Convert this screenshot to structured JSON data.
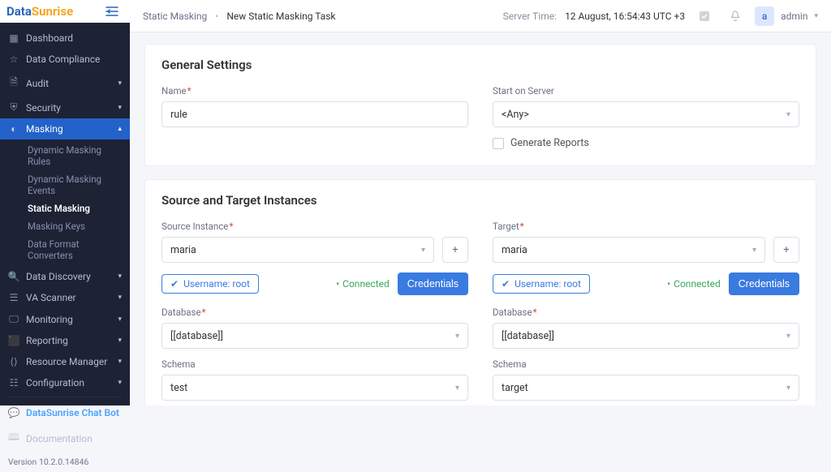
{
  "brand": {
    "part1": "Data",
    "part2": "Sunrise"
  },
  "sidebar": {
    "items": [
      {
        "label": "Dashboard"
      },
      {
        "label": "Data Compliance"
      },
      {
        "label": "Audit"
      },
      {
        "label": "Security"
      },
      {
        "label": "Masking"
      },
      {
        "label": "Data Discovery"
      },
      {
        "label": "VA Scanner"
      },
      {
        "label": "Monitoring"
      },
      {
        "label": "Reporting"
      },
      {
        "label": "Resource Manager"
      },
      {
        "label": "Configuration"
      }
    ],
    "masking_sub": [
      {
        "label": "Dynamic Masking Rules"
      },
      {
        "label": "Dynamic Masking Events"
      },
      {
        "label": "Static Masking"
      },
      {
        "label": "Masking Keys"
      },
      {
        "label": "Data Format Converters"
      }
    ],
    "chatbot": "DataSunrise Chat Bot",
    "documentation": "Documentation",
    "version": "Version 10.2.0.14846"
  },
  "breadcrumb": {
    "root": "Static Masking",
    "current": "New Static Masking Task"
  },
  "header": {
    "server_time_label": "Server Time:",
    "server_time_value": "12 August, 16:54:43  UTC +3",
    "avatar_letter": "a",
    "username": "admin"
  },
  "general": {
    "heading": "General Settings",
    "name_label": "Name",
    "name_value": "rule",
    "start_label": "Start on Server",
    "start_value": "<Any>",
    "generate_reports": "Generate Reports"
  },
  "instances": {
    "heading": "Source and Target Instances",
    "source": {
      "instance_label": "Source Instance",
      "instance_value": "maria",
      "username_chip": "Username: root",
      "connected": "Connected",
      "credentials": "Credentials",
      "db_label": "Database",
      "db_value": "[[database]]",
      "schema_label": "Schema",
      "schema_value": "test"
    },
    "target": {
      "instance_label": "Target",
      "instance_value": "maria",
      "username_chip": "Username: root",
      "connected": "Connected",
      "credentials": "Credentials",
      "db_label": "Database",
      "db_value": "[[database]]",
      "schema_label": "Schema",
      "schema_value": "target"
    }
  }
}
